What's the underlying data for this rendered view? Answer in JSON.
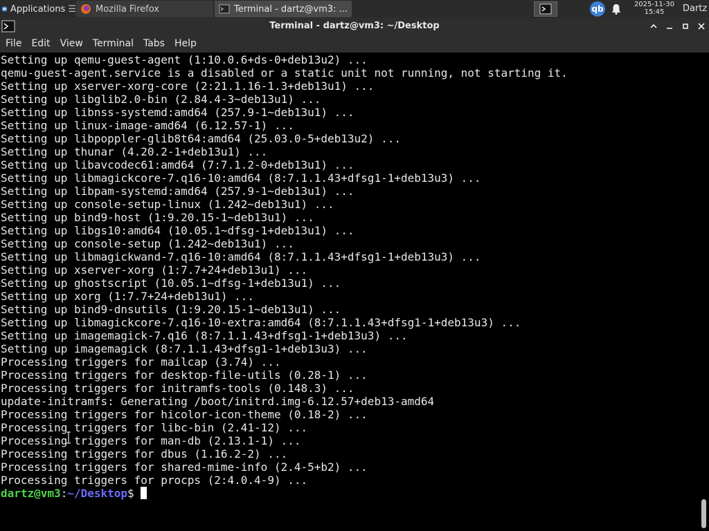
{
  "panel": {
    "applications_label": "Applications",
    "tasks": [
      {
        "label": "Mozilla Firefox"
      },
      {
        "label": "Terminal - dartz@vm3: ..."
      }
    ],
    "qb_label": "qb",
    "clock_date": "2025-11-30",
    "clock_time": "15:45",
    "user": "Dartz"
  },
  "window": {
    "title": "Terminal - dartz@vm3: ~/Desktop"
  },
  "menu": [
    "File",
    "Edit",
    "View",
    "Terminal",
    "Tabs",
    "Help"
  ],
  "terminal": {
    "lines": [
      "Setting up qemu-guest-agent (1:10.0.6+ds-0+deb13u2) ...",
      "qemu-guest-agent.service is a disabled or a static unit not running, not starting it.",
      "Setting up xserver-xorg-core (2:21.1.16-1.3+deb13u1) ...",
      "Setting up libglib2.0-bin (2.84.4-3~deb13u1) ...",
      "Setting up libnss-systemd:amd64 (257.9-1~deb13u1) ...",
      "Setting up linux-image-amd64 (6.12.57-1) ...",
      "Setting up libpoppler-glib8t64:amd64 (25.03.0-5+deb13u2) ...",
      "Setting up thunar (4.20.2-1+deb13u1) ...",
      "Setting up libavcodec61:amd64 (7:7.1.2-0+deb13u1) ...",
      "Setting up libmagickcore-7.q16-10:amd64 (8:7.1.1.43+dfsg1-1+deb13u3) ...",
      "Setting up libpam-systemd:amd64 (257.9-1~deb13u1) ...",
      "Setting up console-setup-linux (1.242~deb13u1) ...",
      "Setting up bind9-host (1:9.20.15-1~deb13u1) ...",
      "Setting up libgs10:amd64 (10.05.1~dfsg-1+deb13u1) ...",
      "Setting up console-setup (1.242~deb13u1) ...",
      "Setting up libmagickwand-7.q16-10:amd64 (8:7.1.1.43+dfsg1-1+deb13u3) ...",
      "Setting up xserver-xorg (1:7.7+24+deb13u1) ...",
      "Setting up ghostscript (10.05.1~dfsg-1+deb13u1) ...",
      "Setting up xorg (1:7.7+24+deb13u1) ...",
      "Setting up bind9-dnsutils (1:9.20.15-1~deb13u1) ...",
      "Setting up libmagickcore-7.q16-10-extra:amd64 (8:7.1.1.43+dfsg1-1+deb13u3) ...",
      "Setting up imagemagick-7.q16 (8:7.1.1.43+dfsg1-1+deb13u3) ...",
      "Setting up imagemagick (8:7.1.1.43+dfsg1-1+deb13u3) ...",
      "Processing triggers for mailcap (3.74) ...",
      "Processing triggers for desktop-file-utils (0.28-1) ...",
      "Processing triggers for initramfs-tools (0.148.3) ...",
      "update-initramfs: Generating /boot/initrd.img-6.12.57+deb13-amd64",
      "Processing triggers for hicolor-icon-theme (0.18-2) ...",
      "Processing triggers for libc-bin (2.41-12) ...",
      "Processing triggers for man-db (2.13.1-1) ...",
      "Processing triggers for dbus (1.16.2-2) ...",
      "Processing triggers for shared-mime-info (2.4-5+b2) ...",
      "Processing triggers for procps (2:4.0.4-9) ..."
    ],
    "prompt_user": "dartz@vm3",
    "prompt_sep": ":",
    "prompt_path": "~/Desktop",
    "prompt_symbol": "$"
  }
}
